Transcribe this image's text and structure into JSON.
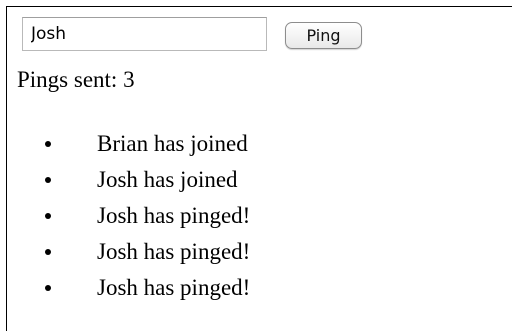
{
  "form": {
    "name_value": "Josh",
    "ping_label": "Ping"
  },
  "status": {
    "label": "Pings sent:",
    "count": 3
  },
  "events": [
    "Brian has joined",
    "Josh has joined",
    "Josh has pinged!",
    "Josh has pinged!",
    "Josh has pinged!"
  ]
}
